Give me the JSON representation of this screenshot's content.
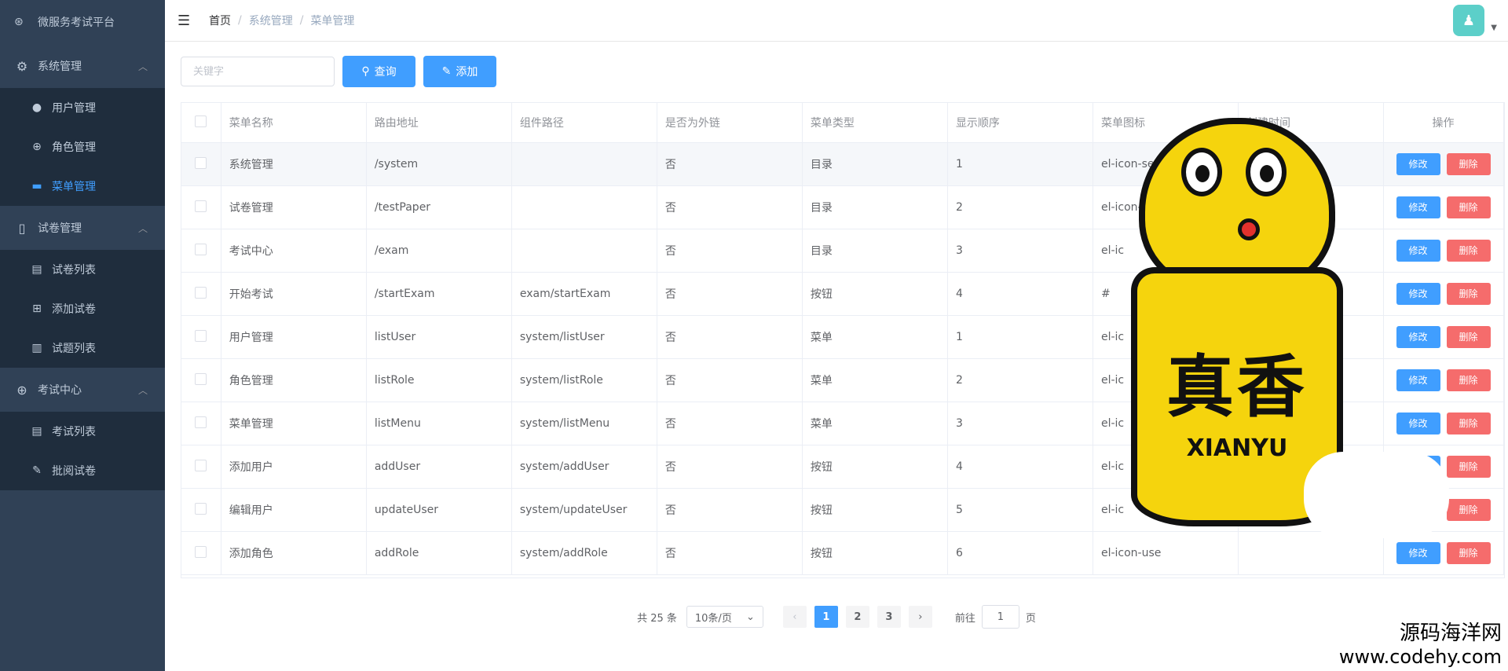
{
  "app": {
    "title": "微服务考试平台"
  },
  "sidebar": {
    "groups": [
      {
        "label": "系统管理",
        "icon": "gear-icon",
        "items": [
          {
            "label": "用户管理",
            "icon": "user-icon",
            "active": false
          },
          {
            "label": "角色管理",
            "icon": "role-icon",
            "active": false
          },
          {
            "label": "菜单管理",
            "icon": "monitor-icon",
            "active": true
          }
        ]
      },
      {
        "label": "试卷管理",
        "icon": "book-icon",
        "items": [
          {
            "label": "试卷列表",
            "icon": "document-icon"
          },
          {
            "label": "添加试卷",
            "icon": "add-document-icon"
          },
          {
            "label": "试题列表",
            "icon": "list-icon"
          }
        ]
      },
      {
        "label": "考试中心",
        "icon": "compass-icon",
        "items": [
          {
            "label": "考试列表",
            "icon": "document-icon"
          },
          {
            "label": "批阅试卷",
            "icon": "edit-icon"
          }
        ]
      }
    ]
  },
  "breadcrumb": {
    "home": "首页",
    "parent": "系统管理",
    "current": "菜单管理",
    "separator": "/"
  },
  "toolbar": {
    "search_placeholder": "关键字",
    "query_label": "查询",
    "add_label": "添加"
  },
  "table": {
    "columns": [
      "菜单名称",
      "路由地址",
      "组件路径",
      "是否为外链",
      "菜单类型",
      "显示顺序",
      "菜单图标",
      "创建时间",
      "操作"
    ],
    "edit_label": "修改",
    "delete_label": "删除",
    "rows": [
      {
        "name": "系统管理",
        "path": "/system",
        "component": "",
        "external": "否",
        "type": "目录",
        "order": "1",
        "icon": "el-icon-setting",
        "created": ":55"
      },
      {
        "name": "试卷管理",
        "path": "/testPaper",
        "component": "",
        "external": "否",
        "type": "目录",
        "order": "2",
        "icon": "el-icon-note",
        "created": "18"
      },
      {
        "name": "考试中心",
        "path": "/exam",
        "component": "",
        "external": "否",
        "type": "目录",
        "order": "3",
        "icon": "el-ic",
        "created": ""
      },
      {
        "name": "开始考试",
        "path": "/startExam",
        "component": "exam/startExam",
        "external": "否",
        "type": "按钮",
        "order": "4",
        "icon": "#",
        "created": ""
      },
      {
        "name": "用户管理",
        "path": "listUser",
        "component": "system/listUser",
        "external": "否",
        "type": "菜单",
        "order": "1",
        "icon": "el-ic",
        "created": ""
      },
      {
        "name": "角色管理",
        "path": "listRole",
        "component": "system/listRole",
        "external": "否",
        "type": "菜单",
        "order": "2",
        "icon": "el-ic",
        "created": ""
      },
      {
        "name": "菜单管理",
        "path": "listMenu",
        "component": "system/listMenu",
        "external": "否",
        "type": "菜单",
        "order": "3",
        "icon": "el-ic",
        "created": ""
      },
      {
        "name": "添加用户",
        "path": "addUser",
        "component": "system/addUser",
        "external": "否",
        "type": "按钮",
        "order": "4",
        "icon": "el-ic",
        "created": ""
      },
      {
        "name": "编辑用户",
        "path": "updateUser",
        "component": "system/updateUser",
        "external": "否",
        "type": "按钮",
        "order": "5",
        "icon": "el-ic",
        "created": ""
      },
      {
        "name": "添加角色",
        "path": "addRole",
        "component": "system/addRole",
        "external": "否",
        "type": "按钮",
        "order": "6",
        "icon": "el-icon-use",
        "created": ""
      }
    ]
  },
  "pagination": {
    "total_text": "共 25 条",
    "page_size": "10条/页",
    "pages": [
      "1",
      "2",
      "3"
    ],
    "current": "1",
    "goto_label": "前往",
    "goto_value": "1",
    "page_suffix": "页"
  },
  "overlay": {
    "sticker_title": "真香",
    "sticker_subtitle": "XIANYU",
    "watermark_line1": "源码海洋网",
    "watermark_line2": "www.codehy.com"
  },
  "colors": {
    "sidebar_bg": "#304156",
    "submenu_bg": "#1f2d3d",
    "primary": "#409eff",
    "danger": "#f56c6c",
    "avatar_bg": "#5ccfc9"
  }
}
